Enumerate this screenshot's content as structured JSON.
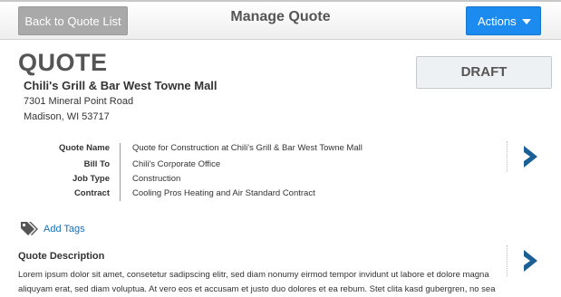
{
  "header": {
    "back_label": "Back to Quote List",
    "title": "Manage Quote",
    "actions_label": "Actions"
  },
  "quote": {
    "heading": "QUOTE",
    "status": "DRAFT",
    "customer": "Chili's Grill & Bar West Towne Mall",
    "address_line1": "7301 Mineral Point Road",
    "address_line2": "Madison, WI 53717"
  },
  "details": [
    {
      "label": "Quote Name",
      "value": "Quote for Construction at Chili's Grill & Bar West Towne Mall"
    },
    {
      "label": "Bill To",
      "value": "Chili's Corporate Office"
    },
    {
      "label": "Job Type",
      "value": "Construction"
    },
    {
      "label": "Contract",
      "value": "Cooling Pros Heating and Air Standard Contract"
    }
  ],
  "tags": {
    "add_label": "Add Tags",
    "icon": "tag-icon"
  },
  "description": {
    "heading": "Quote Description",
    "text": "Lorem ipsum dolor sit amet, consetetur sadipscing elitr, sed diam nonumy eirmod tempor invidunt ut labore et dolore magna aliquyam erat, sed diam voluptua. At vero eos et accusam et justo duo dolores et ea rebum. Stet clita kasd gubergren, no sea"
  },
  "colors": {
    "accent": "#1b8bf0",
    "chevron": "#1a5f96",
    "link": "#1a6fb5"
  }
}
